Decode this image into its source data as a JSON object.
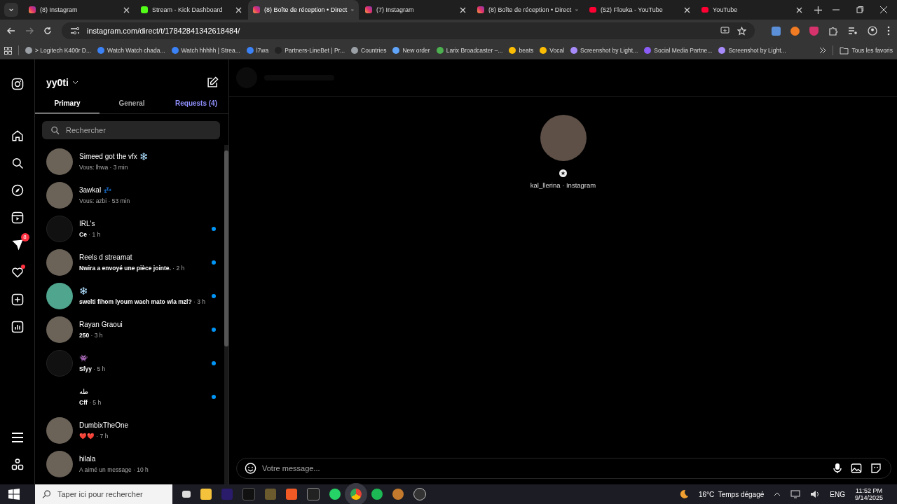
{
  "browser": {
    "tabs": [
      {
        "title": "(8) Instagram",
        "kind": "instagram",
        "selected": false
      },
      {
        "title": "Stream - Kick Dashboard",
        "kind": "kick",
        "selected": false
      },
      {
        "title": "(8) Boîte de réception • Direct",
        "kind": "instagram",
        "selected": true
      },
      {
        "title": "(7) Instagram",
        "kind": "instagram",
        "selected": false
      },
      {
        "title": "(8) Boîte de réception • Direct",
        "kind": "instagram",
        "selected": false
      },
      {
        "title": "(52) Flouka - YouTube",
        "kind": "youtube",
        "selected": false
      },
      {
        "title": "YouTube",
        "kind": "youtube",
        "selected": false
      }
    ],
    "url": "instagram.com/direct/t/17842841342618484/",
    "bookmarks": [
      {
        "label": "> Logitech K400r D...",
        "kind": "globe"
      },
      {
        "label": "Watch Watch chada...",
        "kind": "link"
      },
      {
        "label": "Watch hhhhh | Strea...",
        "kind": "link"
      },
      {
        "label": "l7wa",
        "kind": "link"
      },
      {
        "label": "Partners-LineBet | Pr...",
        "kind": "lb"
      },
      {
        "label": "Countries",
        "kind": "globe"
      },
      {
        "label": "New order",
        "kind": "hand"
      },
      {
        "label": "Larix Broadcaster –...",
        "kind": "bar"
      },
      {
        "label": "beats",
        "kind": "drive"
      },
      {
        "label": "Vocal",
        "kind": "drive"
      },
      {
        "label": "Screenshot by Light...",
        "kind": "feather"
      },
      {
        "label": "Social Media Partne...",
        "kind": "circle"
      },
      {
        "label": "Screenshot by Light...",
        "kind": "feather"
      }
    ],
    "all_bookmarks": "Tous les favoris"
  },
  "nav": {
    "messages_badge": "8",
    "notifications_dot": true
  },
  "inbox": {
    "username": "yy0ti",
    "tabs": [
      {
        "label": "Primary",
        "selected": true
      },
      {
        "label": "General",
        "selected": false
      },
      {
        "label": "Requests (4)",
        "selected": false
      }
    ],
    "search": {
      "placeholder": "Rechercher"
    },
    "conversations": [
      {
        "name": "Simeed got the vfx ❄️",
        "preview": "Vous: lhwa",
        "time": "· 3 min",
        "unread": false,
        "kind": "photo"
      },
      {
        "name": "3awkal 💤",
        "preview": "Vous: azbi",
        "time": "· 53 min",
        "unread": false,
        "kind": "photo"
      },
      {
        "name": "IRL's",
        "preview": "Ce",
        "time": "· 1 h",
        "unread": true,
        "kind": "empty"
      },
      {
        "name": "Reels d streamat",
        "preview": "Nwira a envoyé une pièce jointe.",
        "time": "· 2 h",
        "unread": true,
        "kind": "photo"
      },
      {
        "name": "❄️",
        "preview": "swelti fihom lyoum wach mato wla mzl?",
        "time": "· 3 h",
        "unread": true,
        "kind": "robot"
      },
      {
        "name": "Rayan Graoui",
        "preview": "250",
        "time": "· 3 h",
        "unread": true,
        "kind": "photo"
      },
      {
        "name": "👾",
        "preview": "Sfyy",
        "time": "· 5 h",
        "unread": true,
        "kind": "empty"
      },
      {
        "name": "طه",
        "preview": "Cff",
        "time": "· 5 h",
        "unread": true,
        "kind": "none"
      },
      {
        "name": "DumbixTheOne",
        "preview": "❤️❤️",
        "time": "· 7 h",
        "unread": false,
        "kind": "photo"
      },
      {
        "name": "hilala",
        "preview": "A aimé un message",
        "time": "· 10 h",
        "unread": false,
        "kind": "photo"
      }
    ]
  },
  "chat": {
    "profile_caption": "kal_llerina · Instagram",
    "composer": {
      "placeholder": "Votre message..."
    }
  },
  "taskbar": {
    "search": {
      "placeholder": "Taper ici pour rechercher"
    },
    "weather": "16°C  Temps dégagé",
    "language": "ENG",
    "time": "11:52 PM",
    "date": "9/14/2025"
  }
}
